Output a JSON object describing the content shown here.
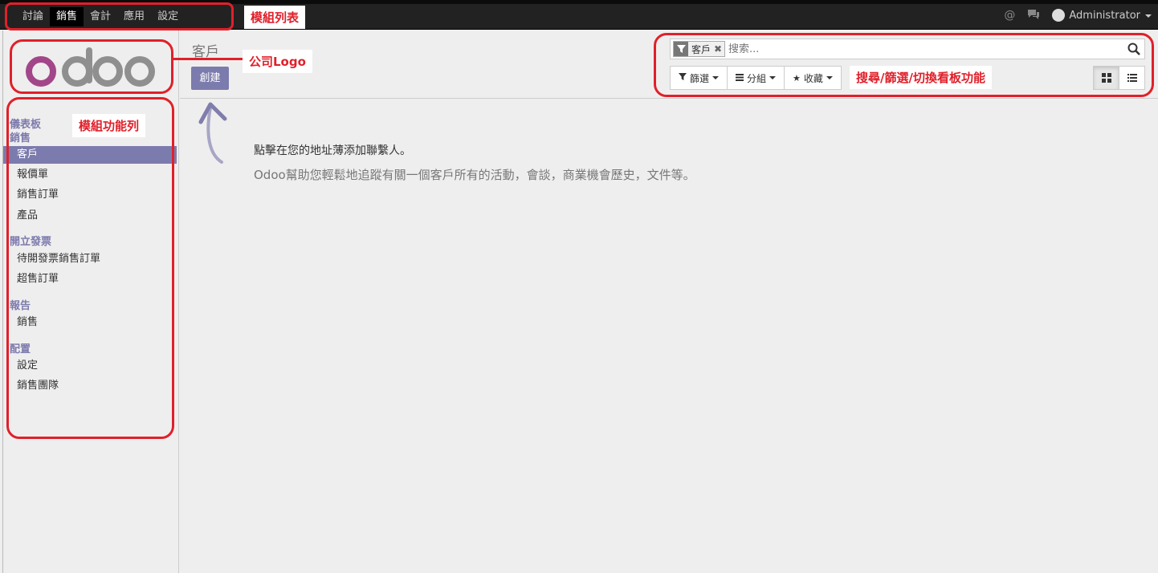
{
  "topbar": {
    "menu": [
      {
        "label": "討論",
        "active": false
      },
      {
        "label": "銷售",
        "active": true
      },
      {
        "label": "會計",
        "active": false
      },
      {
        "label": "應用",
        "active": false
      },
      {
        "label": "設定",
        "active": false
      }
    ],
    "user_name": "Administrator"
  },
  "sidebar": {
    "logo_text": "odoo",
    "sections": {
      "dashboard": "儀表板",
      "sales": "銷售",
      "invoicing": "開立發票",
      "reports": "報告",
      "config": "配置"
    },
    "items": {
      "customers": "客戶",
      "quotations": "報價單",
      "sales_orders": "銷售訂單",
      "products": "產品",
      "orders_to_invoice": "待開發票銷售訂單",
      "upselling": "超售訂單",
      "sales_report": "銷售",
      "settings": "設定",
      "sales_teams": "銷售團隊"
    }
  },
  "control_panel": {
    "breadcrumb": "客戶",
    "create_label": "創建",
    "search": {
      "facet": "客戶",
      "placeholder": "搜索..."
    },
    "filters_label": "篩選",
    "groupby_label": "分組",
    "favorites_label": "收藏"
  },
  "help": {
    "title": "點擊在您的地址薄添加聯繫人。",
    "text": "Odoo幫助您輕鬆地追蹤有關一個客戶所有的活動，會談，商業機會歷史，文件等。"
  },
  "annotations": {
    "module_list": "模組列表",
    "company_logo": "公司Logo",
    "module_menu": "模組功能列",
    "search_filter": "搜尋/篩選/切換看板功能"
  },
  "colors": {
    "accent": "#7c7bad",
    "annotation": "#e0202a",
    "navbar": "#222222"
  }
}
